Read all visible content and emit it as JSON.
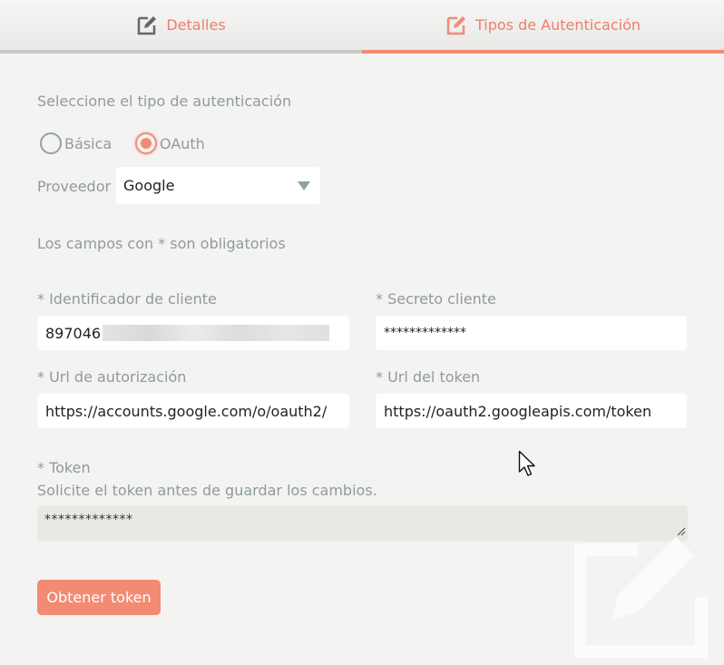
{
  "tabs": [
    {
      "label": "Detalles",
      "icon": "edit-icon"
    },
    {
      "label": "Tipos de Autenticación",
      "icon": "edit-icon",
      "active": true
    }
  ],
  "auth_type_prompt": "Seleccione el tipo de autenticación",
  "auth_options": [
    {
      "label": "Básica",
      "checked": false
    },
    {
      "label": "OAuth",
      "checked": true
    }
  ],
  "provider": {
    "label": "Proveedor",
    "value": "Google"
  },
  "required_note": "Los campos con * son obligatorios",
  "fields": {
    "client_id": {
      "label": "* Identificador de cliente",
      "value": "897046"
    },
    "client_secret": {
      "label": "* Secreto cliente",
      "value": "*************"
    },
    "auth_url": {
      "label": "* Url de autorización",
      "value": "https://accounts.google.com/o/oauth2/"
    },
    "token_url": {
      "label": "* Url del token",
      "value": "https://oauth2.googleapis.com/token"
    }
  },
  "token": {
    "label": "* Token",
    "hint": "Solicite el token antes de guardar los cambios.",
    "value": "*************"
  },
  "get_token_button": "Obtener token",
  "colors": {
    "accent": "#f28b73",
    "muted_text": "#8f9c97",
    "background": "#f3f3f1"
  }
}
